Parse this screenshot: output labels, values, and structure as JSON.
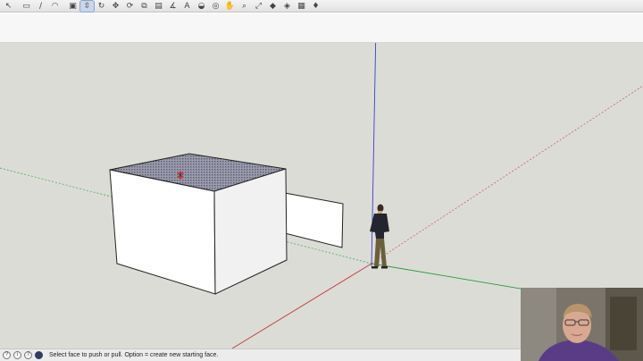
{
  "toolbar": {
    "tools": [
      {
        "name": "select-tool-icon",
        "glyph": "↖"
      },
      {
        "name": "eraser-tool-icon",
        "glyph": "▭"
      },
      {
        "name": "line-tool-icon",
        "glyph": "∕"
      },
      {
        "name": "arc-tool-icon",
        "glyph": "◠"
      },
      {
        "name": "rectangle-tool-icon",
        "glyph": "▣"
      },
      {
        "name": "push-pull-tool-icon",
        "glyph": "⇳"
      },
      {
        "name": "rotate-tool-icon",
        "glyph": "↻"
      },
      {
        "name": "move-tool-icon",
        "glyph": "✥"
      },
      {
        "name": "follow-me-tool-icon",
        "glyph": "⟳"
      },
      {
        "name": "scale-tool-icon",
        "glyph": "⧉"
      },
      {
        "name": "offset-tool-icon",
        "glyph": "▤"
      },
      {
        "name": "tape-measure-tool-icon",
        "glyph": "∡"
      },
      {
        "name": "text-tool-icon",
        "glyph": "A"
      },
      {
        "name": "paint-bucket-tool-icon",
        "glyph": "◒"
      },
      {
        "name": "orbit-tool-icon",
        "glyph": "◎"
      },
      {
        "name": "pan-tool-icon",
        "glyph": "✋"
      },
      {
        "name": "zoom-tool-icon",
        "glyph": "⌕"
      },
      {
        "name": "zoom-extents-tool-icon",
        "glyph": "⤢"
      },
      {
        "name": "warehouse-icon",
        "glyph": "◆"
      },
      {
        "name": "extension-warehouse-icon",
        "glyph": "◈"
      },
      {
        "name": "layout-icon",
        "glyph": "▦"
      },
      {
        "name": "ruby-icon",
        "glyph": "♦"
      }
    ],
    "active_tool_index": 5
  },
  "status": {
    "message": "Select face to push or pull.  Option = create new starting face."
  },
  "colors": {
    "viewport_background": "#dcdcd6",
    "blue_axis": "#3b3bd6",
    "green_axis": "#1e9e3a",
    "red_axis": "#c43a3a",
    "selected_face": "#7d7d92"
  }
}
